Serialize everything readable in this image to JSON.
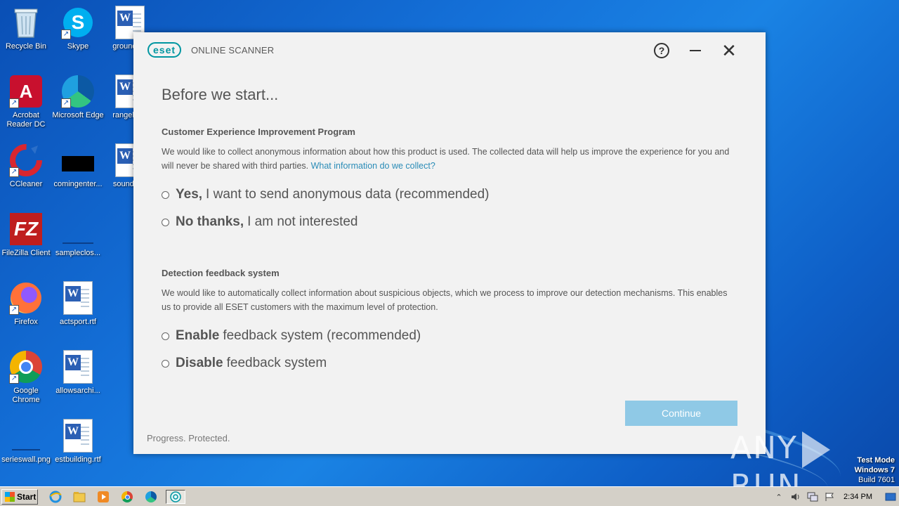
{
  "desktop": {
    "icons": [
      {
        "label": "Recycle Bin"
      },
      {
        "label": "Skype"
      },
      {
        "label": "grounde..."
      },
      {
        "label": "Acrobat Reader DC"
      },
      {
        "label": "Microsoft Edge"
      },
      {
        "label": "rangehu..."
      },
      {
        "label": "CCleaner"
      },
      {
        "label": "comingenter..."
      },
      {
        "label": "soundar..."
      },
      {
        "label": "FileZilla Client"
      },
      {
        "label": "sampleclos..."
      },
      {
        "label": "Firefox"
      },
      {
        "label": "actsport.rtf"
      },
      {
        "label": "Google Chrome"
      },
      {
        "label": "allowsarchi..."
      },
      {
        "label": "serieswall.png"
      },
      {
        "label": "estbuilding.rtf"
      }
    ]
  },
  "dialog": {
    "logo": "eset",
    "app_name": "ONLINE SCANNER",
    "help_icon": "?",
    "close_icon": "✕",
    "title": "Before we start...",
    "ceip": {
      "heading": "Customer Experience Improvement Program",
      "text": "We would like to collect anonymous information about how this product is used. The collected data will help us improve the experience for you and will never be shared with third parties.",
      "link": "What information do we collect?",
      "option_yes_bold": "Yes,",
      "option_yes_rest": "I want to send anonymous data (recommended)",
      "option_no_bold": "No thanks,",
      "option_no_rest": "I am not interested"
    },
    "feedback": {
      "heading": "Detection feedback system",
      "text": "We would like to automatically collect information about suspicious objects, which we process to improve our detection mechanisms. This enables us to provide all ESET customers with the maximum level of protection.",
      "option_enable_bold": "Enable",
      "option_enable_rest": "feedback system (recommended)",
      "option_disable_bold": "Disable",
      "option_disable_rest": "feedback system"
    },
    "continue_label": "Continue",
    "footer": "Progress. Protected."
  },
  "watermark": {
    "brand_left": "ANY",
    "brand_right": "RUN",
    "test_mode": "Test Mode",
    "os": "Windows 7",
    "build": "Build 7601"
  },
  "taskbar": {
    "start_label": "Start",
    "clock": "2:34 PM"
  },
  "colors": {
    "eset_teal": "#0096a1",
    "link": "#2a8cb7",
    "continue_disabled": "#8fc9e6"
  }
}
